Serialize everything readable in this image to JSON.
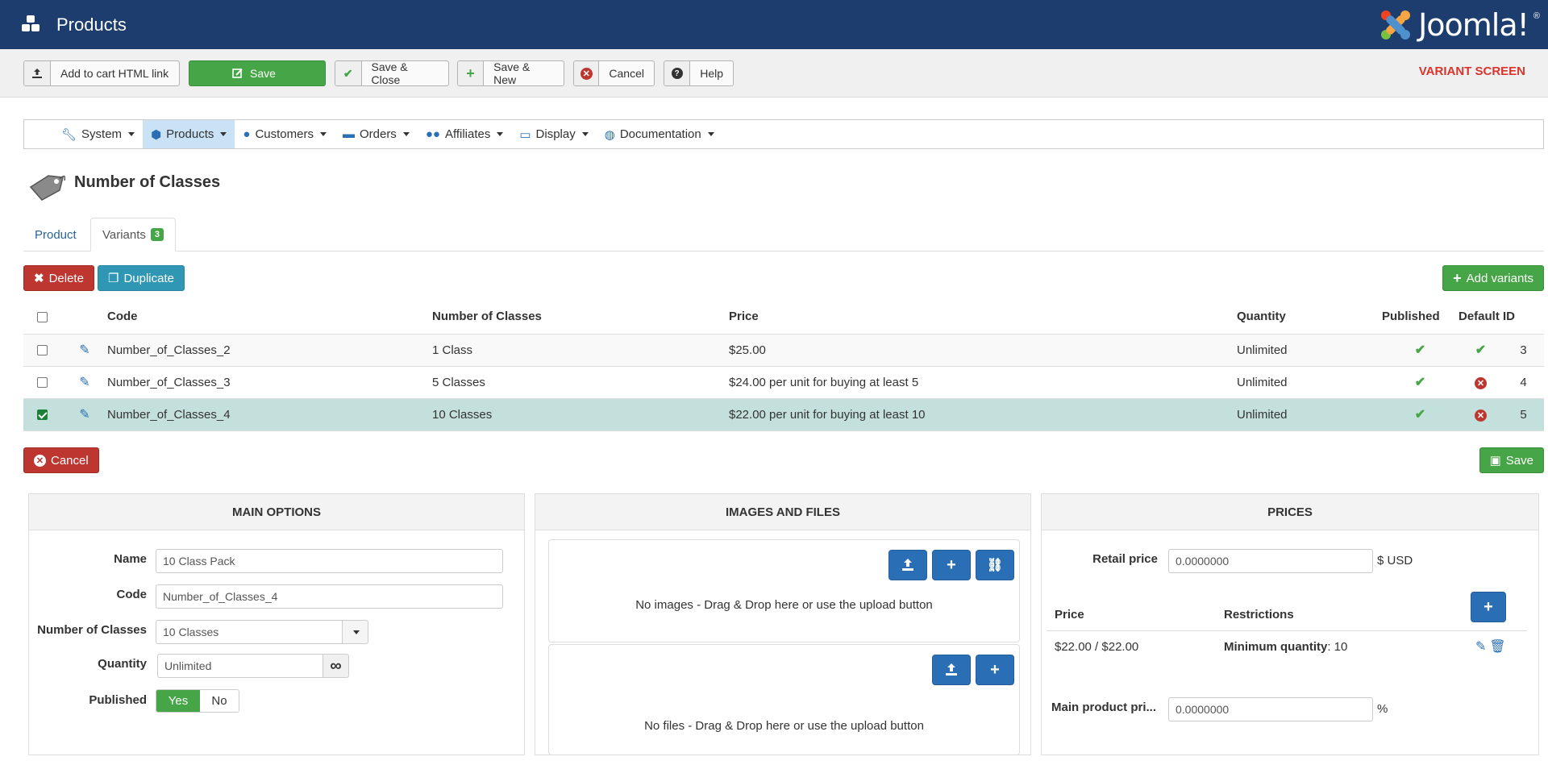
{
  "header": {
    "title": "Products",
    "brand": "Joomla!",
    "brand_mark": "®"
  },
  "toolbar": {
    "add_to_cart": "Add to cart HTML link",
    "save": "Save",
    "save_close": "Save & Close",
    "save_new": "Save & New",
    "cancel": "Cancel",
    "help": "Help",
    "screen_label": "VARIANT SCREEN"
  },
  "menu": [
    "System",
    "Products",
    "Customers",
    "Orders",
    "Affiliates",
    "Display",
    "Documentation"
  ],
  "page": {
    "title": "Number of Classes"
  },
  "tabs": {
    "product": "Product",
    "variants": "Variants",
    "variants_count": "3"
  },
  "actions": {
    "delete": "Delete",
    "duplicate": "Duplicate",
    "add_variants": "Add variants",
    "cancel": "Cancel",
    "save": "Save"
  },
  "table": {
    "columns": {
      "code": "Code",
      "number": "Number of Classes",
      "price": "Price",
      "quantity": "Quantity",
      "published": "Published",
      "default": "Default",
      "id": "ID"
    },
    "rows": [
      {
        "code": "Number_of_Classes_2",
        "number": "1 Class",
        "price": "$25.00",
        "quantity": "Unlimited",
        "id": "3"
      },
      {
        "code": "Number_of_Classes_3",
        "number": "5 Classes",
        "price": "$24.00 per unit for buying at least 5",
        "quantity": "Unlimited",
        "id": "4"
      },
      {
        "code": "Number_of_Classes_4",
        "number": "10 Classes",
        "price": "$22.00 per unit for buying at least 10",
        "quantity": "Unlimited",
        "id": "5"
      }
    ]
  },
  "main_options": {
    "heading": "MAIN OPTIONS",
    "name_label": "Name",
    "name_value": "10 Class Pack",
    "code_label": "Code",
    "code_value": "Number_of_Classes_4",
    "classes_label": "Number of Classes",
    "classes_value": "10 Classes",
    "quantity_label": "Quantity",
    "quantity_value": "Unlimited",
    "published_label": "Published",
    "yes": "Yes",
    "no": "No"
  },
  "images": {
    "heading": "IMAGES AND FILES",
    "no_images": "No images - Drag & Drop here or use the upload button",
    "no_files": "No files - Drag & Drop here or use the upload button"
  },
  "prices": {
    "heading": "PRICES",
    "retail_label": "Retail price",
    "retail_value": "0.0000000",
    "currency": "$ USD",
    "col_price": "Price",
    "col_restrictions": "Restrictions",
    "row_price": "$22.00 / $22.00",
    "row_restriction_label": "Minimum quantity",
    "row_restriction_value": ": 10",
    "main_label": "Main product pri...",
    "main_value": "0.0000000",
    "main_unit": "%"
  }
}
